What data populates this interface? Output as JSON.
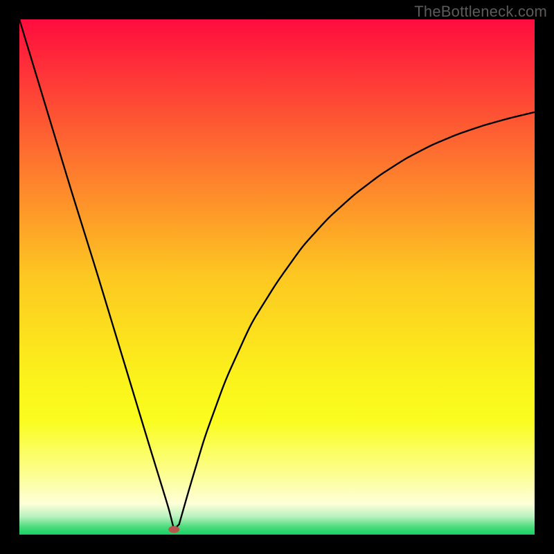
{
  "watermark": "TheBottleneck.com",
  "chart_data": {
    "type": "line",
    "title": "",
    "xlabel": "",
    "ylabel": "",
    "xlim": [
      0,
      100
    ],
    "ylim": [
      0,
      100
    ],
    "gradient_bands": [
      {
        "pos": 0.0,
        "color": "#FF0C3E"
      },
      {
        "pos": 0.25,
        "color": "#FE6B30"
      },
      {
        "pos": 0.5,
        "color": "#FDC821"
      },
      {
        "pos": 0.7,
        "color": "#FBF31B"
      },
      {
        "pos": 0.78,
        "color": "#FAFD1F"
      },
      {
        "pos": 0.88,
        "color": "#FCFE8E"
      },
      {
        "pos": 0.94,
        "color": "#FEFFD8"
      },
      {
        "pos": 0.965,
        "color": "#B8F2C0"
      },
      {
        "pos": 0.985,
        "color": "#4BDC7B"
      },
      {
        "pos": 1.0,
        "color": "#16D165"
      }
    ],
    "curve_comment": "V-shaped curve representing bottleneck percentage. Left branch is a steep line from (0,100) down to the minimum near x=30, y=1. Right branch rises concavely toward about (100,82).",
    "series": [
      {
        "name": "left_branch",
        "x": [
          0,
          5,
          10,
          15,
          20,
          25,
          29,
          30,
          31
        ],
        "values": [
          100,
          83.5,
          67,
          51,
          34.5,
          18,
          5,
          1,
          2
        ]
      },
      {
        "name": "right_branch",
        "x": [
          31,
          33,
          36,
          40,
          45,
          50,
          55,
          60,
          65,
          70,
          75,
          80,
          85,
          90,
          95,
          100
        ],
        "values": [
          2,
          9,
          19,
          30,
          41,
          49,
          56,
          61.5,
          66,
          69.8,
          73,
          75.6,
          77.7,
          79.4,
          80.8,
          82
        ]
      }
    ],
    "min_marker": {
      "x": 30,
      "y": 1,
      "rx": 8,
      "ry": 5,
      "color": "#B6564C"
    }
  }
}
